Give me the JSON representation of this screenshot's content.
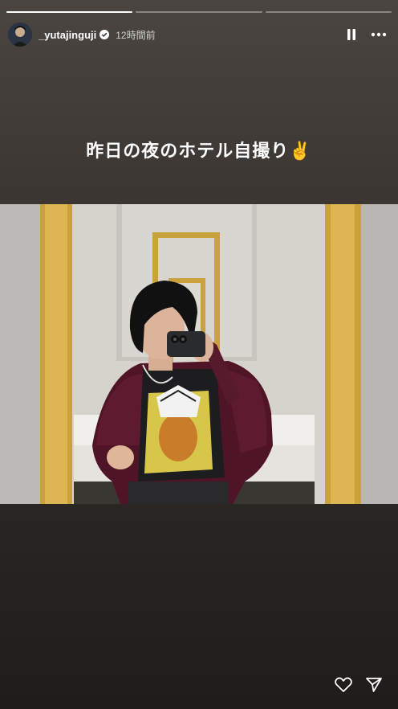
{
  "story": {
    "progress": [
      1.0,
      0.0,
      0.0
    ],
    "user": {
      "username": "_yutajinguji",
      "verified": true,
      "time_ago": "12時間前"
    },
    "caption": "昨日の夜のホテル自撮り✌️",
    "controls": {
      "pause_icon": "pause-icon",
      "more_icon": "more-icon",
      "like_icon": "heart-icon",
      "share_icon": "send-icon"
    }
  }
}
